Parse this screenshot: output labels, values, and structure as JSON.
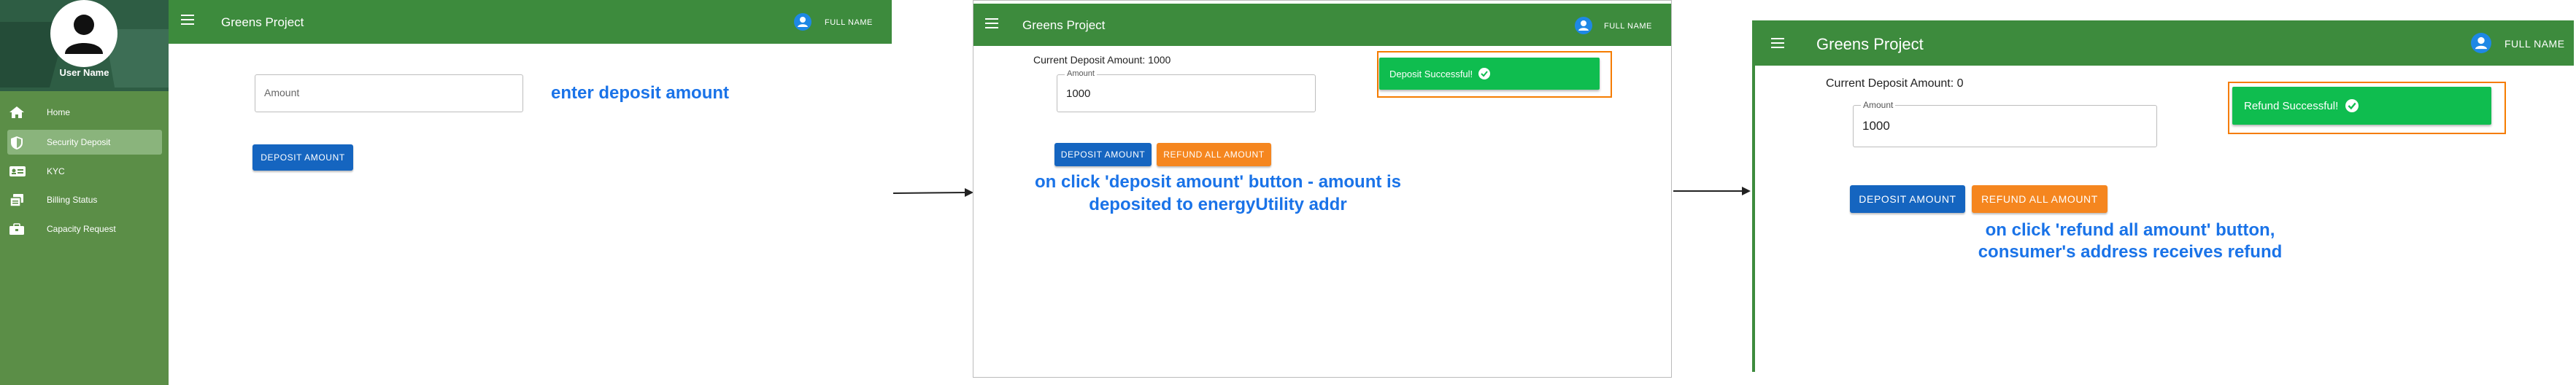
{
  "app_title": "Greens Project",
  "user_name": "User Name",
  "full_name": "FULL NAME",
  "sidebar": {
    "items": [
      {
        "label": "Home",
        "icon": "home-icon"
      },
      {
        "label": "Security Deposit",
        "icon": "shield-icon"
      },
      {
        "label": "KYC",
        "icon": "id-card-icon"
      },
      {
        "label": "Billing Status",
        "icon": "billing-icon"
      },
      {
        "label": "Capacity Request",
        "icon": "briefcase-icon"
      }
    ],
    "active_index": 1
  },
  "panel1": {
    "amount_placeholder": "Amount",
    "deposit_button": "DEPOSIT AMOUNT",
    "annotation": "enter deposit amount"
  },
  "panel2": {
    "current_deposit": "Current Deposit Amount: 1000",
    "amount_label": "Amount",
    "amount_value": "1000",
    "deposit_button": "DEPOSIT AMOUNT",
    "refund_button": "REFUND ALL AMOUNT",
    "toast": "Deposit Successful!",
    "annotation_line1": "on click 'deposit amount' button - amount is",
    "annotation_line2": "deposited to energyUtility addr"
  },
  "panel3": {
    "current_deposit": "Current Deposit Amount: 0",
    "amount_label": "Amount",
    "amount_value": "1000",
    "deposit_button": "DEPOSIT AMOUNT",
    "refund_button": "REFUND ALL AMOUNT",
    "toast": "Refund Successful!",
    "annotation_line1": "on click 'refund all amount' button,",
    "annotation_line2": "consumer's address receives refund"
  },
  "colors": {
    "appbar": "#3d8b3d",
    "sidebar": "#5b8e47",
    "primary_button": "#1565c0",
    "refund_button": "#f5861f",
    "toast": "#0fbd4f",
    "highlight_border": "#f57c00",
    "annotation_text": "#1a73e8"
  }
}
